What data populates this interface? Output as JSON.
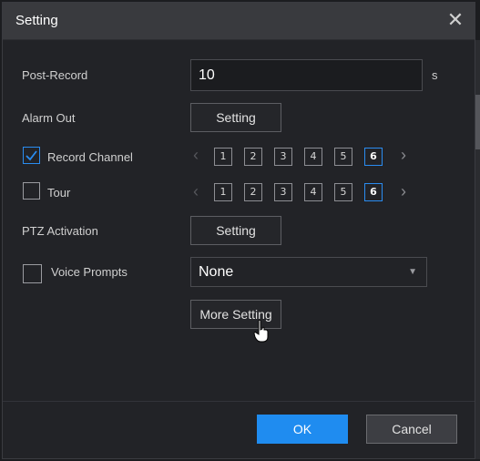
{
  "dialog": {
    "title": "Setting",
    "close_icon": "close-icon"
  },
  "post_record": {
    "label": "Post-Record",
    "value": "10",
    "unit": "s"
  },
  "alarm_out": {
    "label": "Alarm Out",
    "button": "Setting"
  },
  "record_channel": {
    "label": "Record Channel",
    "checked": true,
    "channels": [
      "1",
      "2",
      "3",
      "4",
      "5",
      "6"
    ],
    "active": "6",
    "prev_icon": "chevron-left-icon",
    "next_icon": "chevron-right-icon"
  },
  "tour": {
    "label": "Tour",
    "checked": false,
    "channels": [
      "1",
      "2",
      "3",
      "4",
      "5",
      "6"
    ],
    "active": "6"
  },
  "ptz_activation": {
    "label": "PTZ Activation",
    "button": "Setting"
  },
  "voice_prompts": {
    "label": "Voice Prompts",
    "checked": false,
    "selected": "None",
    "dropdown_icon": "caret-down-icon"
  },
  "more_setting": {
    "button": "More Setting"
  },
  "footer": {
    "ok": "OK",
    "cancel": "Cancel"
  },
  "colors": {
    "accent": "#1f8cf0",
    "background": "#222327",
    "titlebar": "#393a3e"
  }
}
